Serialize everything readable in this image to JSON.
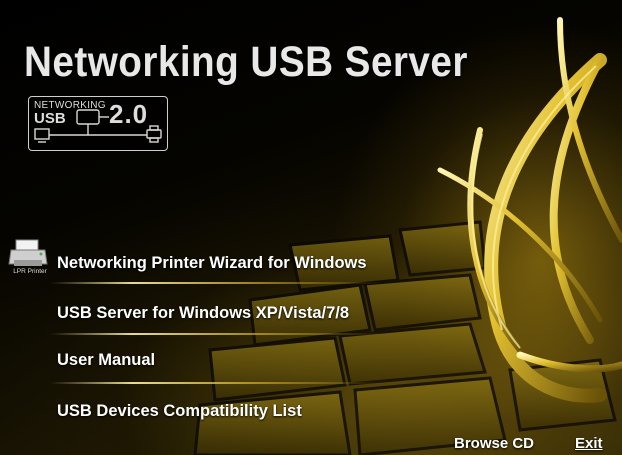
{
  "app": {
    "title": "Networking USB Server"
  },
  "badge": {
    "line1": "NETWORKING",
    "line2": "USB",
    "version": "2.0"
  },
  "menu": {
    "printer_icon_label": "LPR Printer",
    "items": [
      {
        "label": "Networking Printer Wizard for Windows"
      },
      {
        "label": "USB Server for Windows XP/Vista/7/8"
      },
      {
        "label": "User Manual"
      },
      {
        "label": "USB Devices Compatibility List"
      }
    ]
  },
  "footer": {
    "browse_label": "Browse CD",
    "exit_label": "Exit"
  },
  "colors": {
    "accent_gold": "#d4b020",
    "text": "#ffffff",
    "background": "#000000"
  },
  "icons": [
    "printer-icon",
    "computer-icon",
    "server-icon",
    "printer-small-icon"
  ]
}
